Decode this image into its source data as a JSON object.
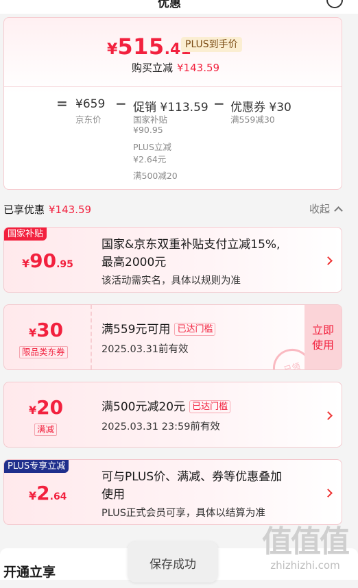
{
  "header": {
    "title": "优惠"
  },
  "summary": {
    "price_yen": "¥",
    "price_int": "515",
    "price_dec": ".41",
    "price_tag": "PLUS到手价",
    "discount_label": "购买立减",
    "discount_value": "¥143.59",
    "equals": "=",
    "jd_price": "¥659",
    "jd_price_label": "京东价",
    "minus1": "−",
    "promo_label": "促销 ¥113.59",
    "promo_items": [
      {
        "name": "国家补贴",
        "value": "¥90.95"
      },
      {
        "name": "PLUS立减",
        "value": "¥2.64元"
      },
      {
        "name": "满500减20",
        "value": ""
      }
    ],
    "minus2": "−",
    "coupon_label": "优惠券 ¥30",
    "coupon_sub": "满559减30"
  },
  "section": {
    "enjoyed_label": "已享优惠",
    "enjoyed_value": "¥143.59",
    "collapse_label": "收起"
  },
  "cards": {
    "national": {
      "tag": "国家补贴",
      "tag_color": "#f2213e",
      "yen": "¥",
      "int": "90",
      "dec": ".95",
      "title_line1": "国家&京东双重补贴支付立减15%,",
      "title_line2": "最高2000元",
      "subtitle": "该活动需实名，具体以规则为准"
    },
    "coupon": {
      "yen": "¥",
      "int": "30",
      "type": "限品类东券",
      "title": "满559元可用",
      "badge": "已达门槛",
      "validity": "2025.03.31前有效",
      "use_line1": "立即",
      "use_line2": "使用",
      "stamp": "已领"
    },
    "fullcut": {
      "yen": "¥",
      "int": "20",
      "type": "满减",
      "title": "满500元减20元",
      "badge": "已达门槛",
      "validity": "2025.03.31 23:59前有效"
    },
    "plus": {
      "tag": "PLUS专享立减",
      "tag_color": "#1f2f8c",
      "yen": "¥",
      "int": "2",
      "dec": ".64",
      "title_line1": "可与PLUS价、满减、券等优惠叠加",
      "title_line2": "使用",
      "subtitle": "PLUS正式会员可享，具体以结算为准"
    }
  },
  "bottom": {
    "title": "开通立享"
  },
  "toast": {
    "text": "保存成功"
  },
  "watermark": {
    "logo": "值值值",
    "domain": "zhizhizhi.com"
  }
}
